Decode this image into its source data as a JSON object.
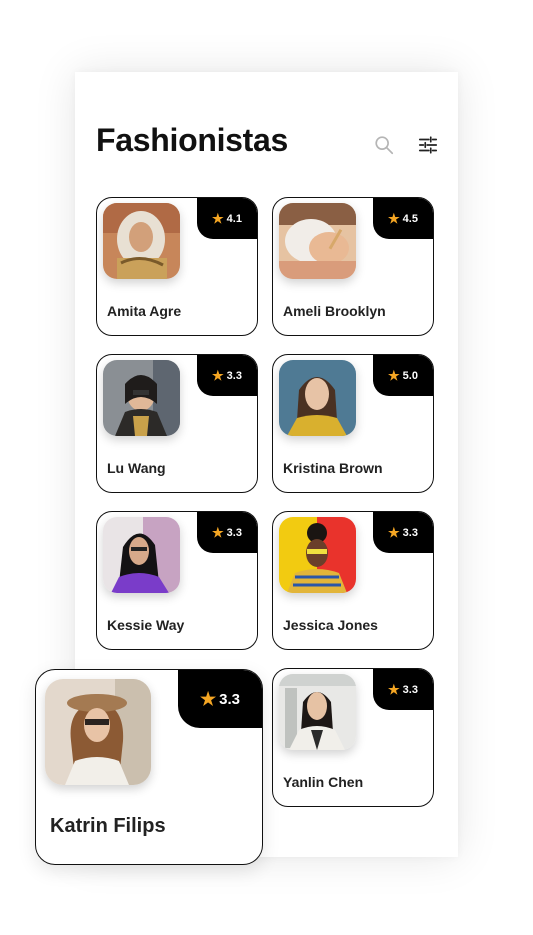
{
  "header": {
    "title": "Fashionistas",
    "search_icon": "search-icon",
    "filter_icon": "filter-sliders-icon"
  },
  "colors": {
    "badge_bg": "#000000",
    "star": "#f5a623",
    "text": "#222222"
  },
  "cards": [
    {
      "name": "Amita Agre",
      "rating": "4.1"
    },
    {
      "name": "Ameli Brooklyn",
      "rating": "4.5"
    },
    {
      "name": "Lu Wang",
      "rating": "3.3"
    },
    {
      "name": "Kristina Brown",
      "rating": "5.0"
    },
    {
      "name": "Kessie Way",
      "rating": "3.3"
    },
    {
      "name": "Jessica Jones",
      "rating": "3.3"
    },
    {
      "name": "Katrin Filips",
      "rating": "3.3"
    },
    {
      "name": "Yanlin Chen",
      "rating": "3.3"
    }
  ]
}
